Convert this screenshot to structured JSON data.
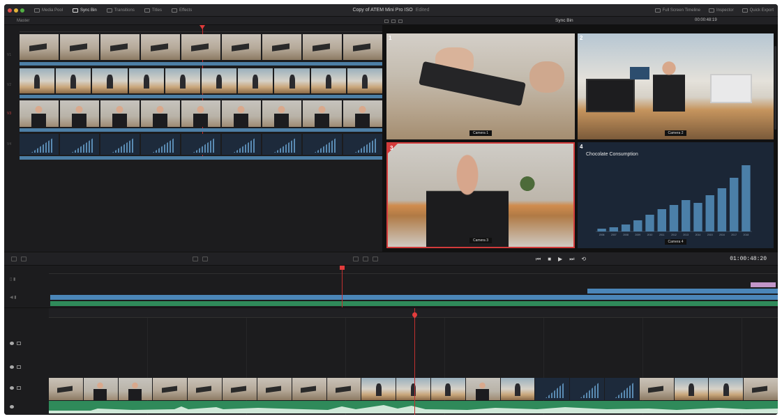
{
  "window": {
    "title": "Copy of ATEM Mini Pro ISO",
    "title_suffix": "Edited",
    "toolbar_left": [
      "Media Pool",
      "Sync Bin",
      "Transitions",
      "Titles",
      "Effects"
    ],
    "toolbar_right": [
      "Full Screen Timeline",
      "Inspector",
      "Quick Export"
    ]
  },
  "source_tape": {
    "label": "Master"
  },
  "viewer": {
    "name": "Sync Bin",
    "timecode": "00:00:48:19",
    "angles": [
      {
        "number": "1",
        "caption": "Camera 1"
      },
      {
        "number": "2",
        "caption": "Camera 2"
      },
      {
        "number": "3",
        "caption": "Camera 3"
      },
      {
        "number": "4",
        "caption": "Camera 4"
      }
    ]
  },
  "transport": {
    "prev": "⏮",
    "stop": "■",
    "play": "▶",
    "next": "⏭",
    "loop": "⟲",
    "timecode": "01:00:48:20"
  },
  "chart_data": {
    "type": "bar",
    "title": "Chocolate Consumption",
    "categories": [
      "2006",
      "2007",
      "2008",
      "2009",
      "2010",
      "2011",
      "2012",
      "2013",
      "2014",
      "2015",
      "2016",
      "2017",
      "2018"
    ],
    "values": [
      4,
      6,
      10,
      16,
      24,
      32,
      38,
      45,
      41,
      52,
      62,
      77,
      95
    ],
    "ylim": [
      0,
      100
    ],
    "bar_color": "#4b7fa8"
  },
  "colors": {
    "accent_red": "#d23b3b",
    "audio_green": "#2f8a5a",
    "video_blue": "#4d7fa6",
    "chart_background": "#1b2636"
  }
}
